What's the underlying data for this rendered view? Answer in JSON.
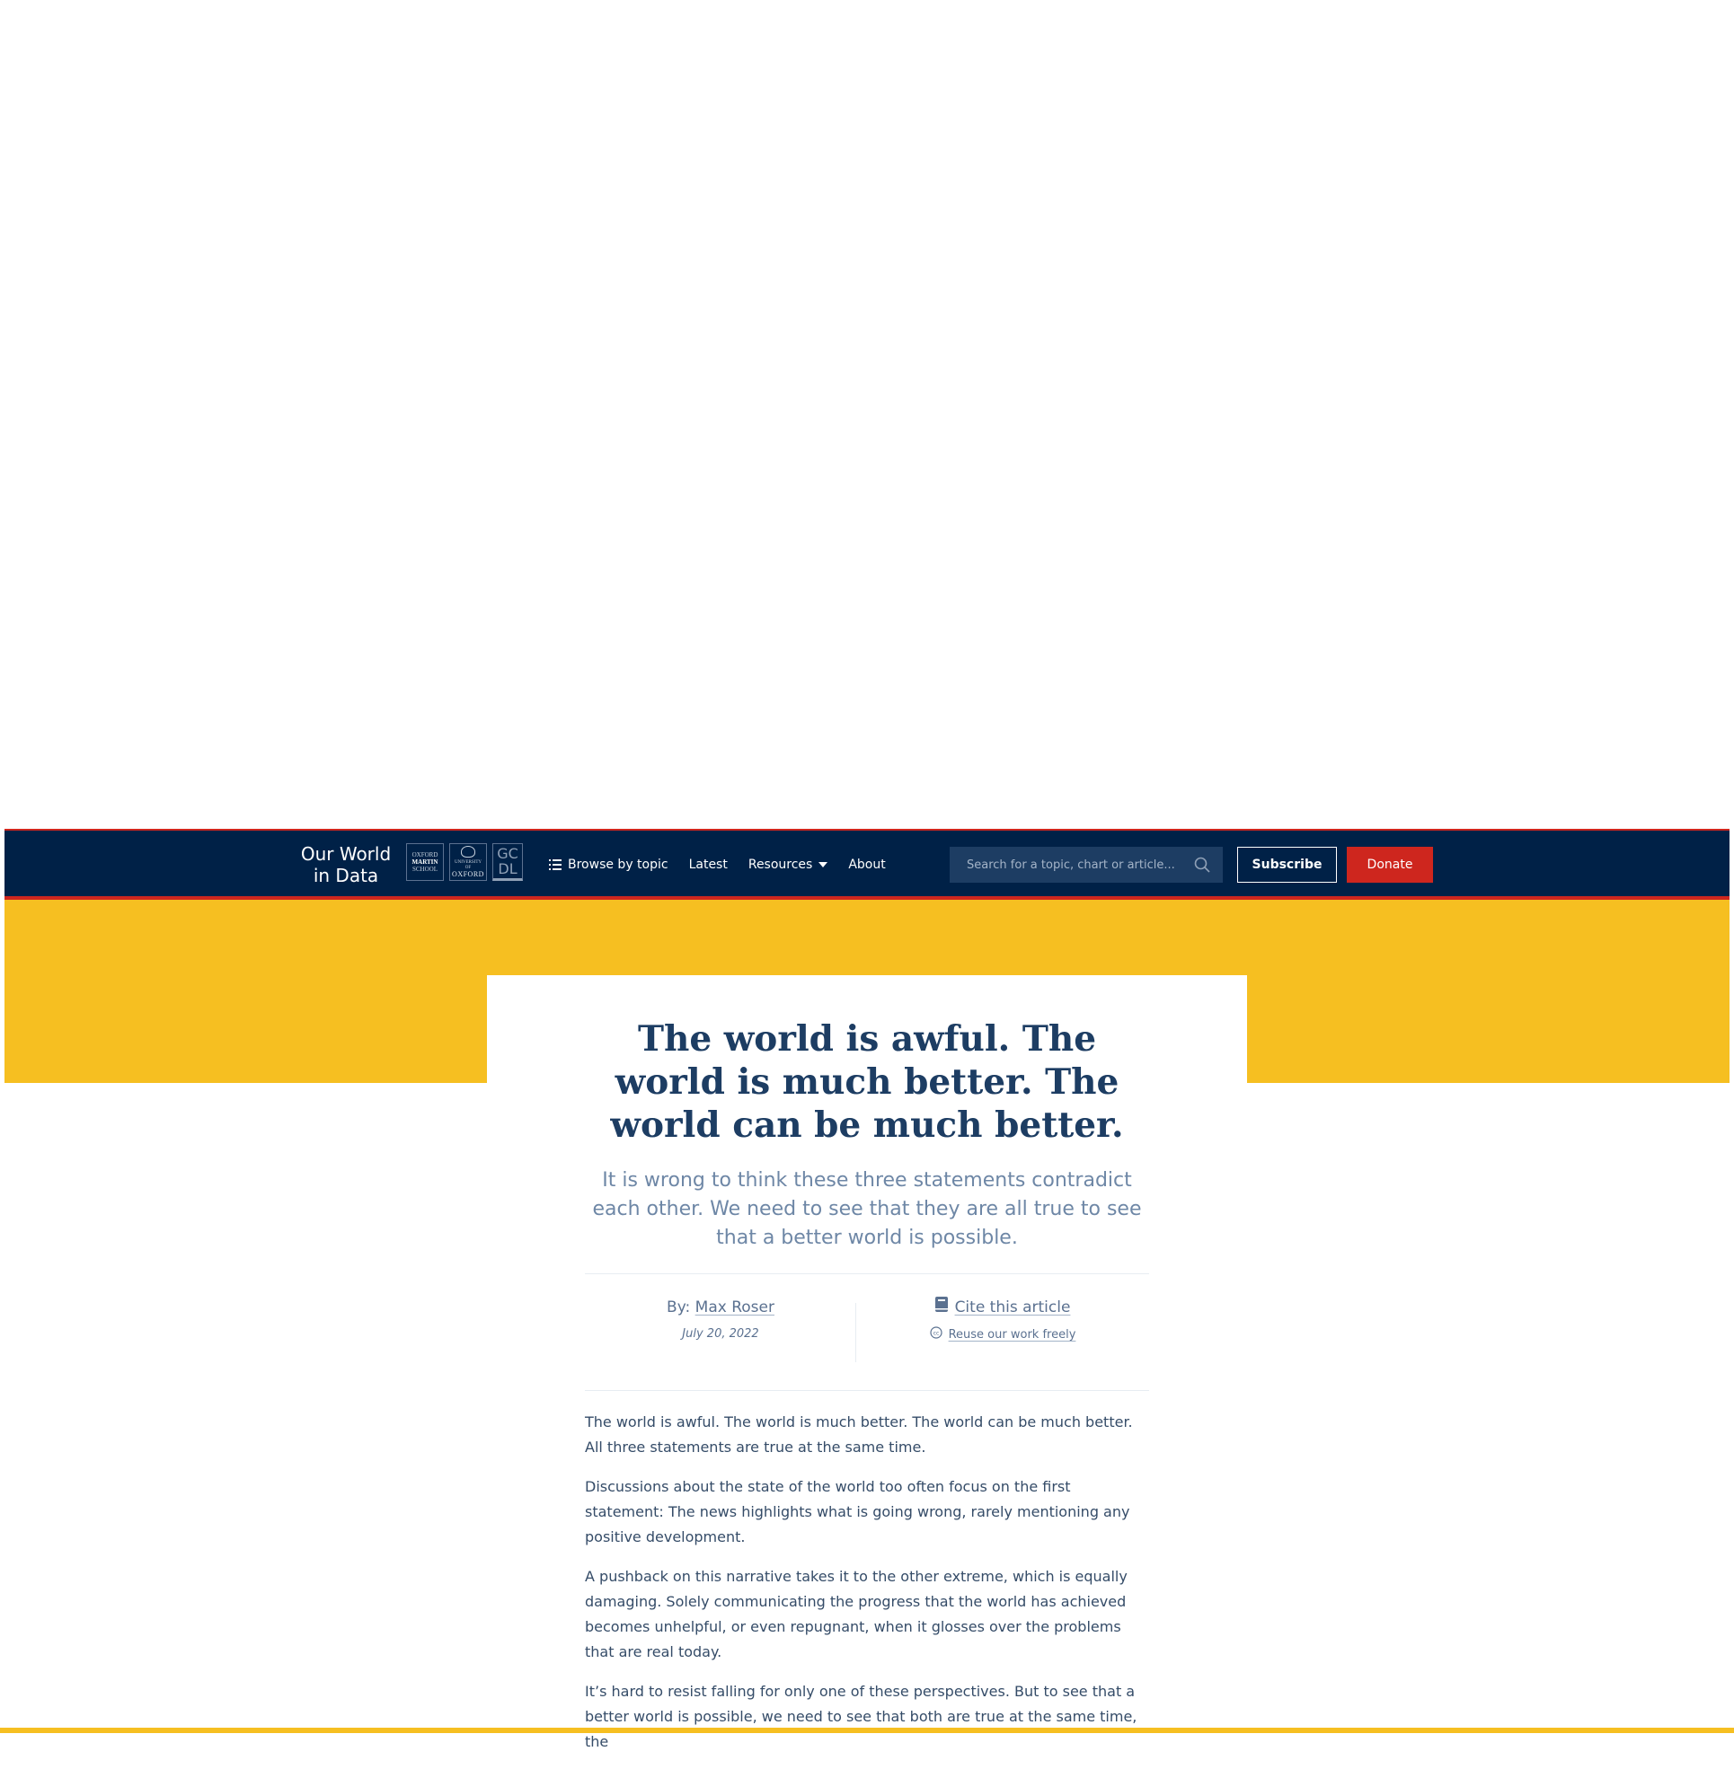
{
  "header": {
    "brand_line1": "Our World",
    "brand_line2": "in Data",
    "partners": {
      "martin": [
        "OXFORD",
        "MARTIN",
        "SCHOOL"
      ],
      "oxford": [
        "UNIVERSITY OF",
        "OXFORD"
      ],
      "gcdl": [
        "GC",
        "DL"
      ]
    },
    "nav": {
      "browse_label": "Browse by topic",
      "latest_label": "Latest",
      "resources_label": "Resources",
      "about_label": "About"
    },
    "search": {
      "placeholder": "Search for a topic, chart or article..."
    },
    "subscribe_label": "Subscribe",
    "donate_label": "Donate"
  },
  "colors": {
    "navy": "#002147",
    "red": "#ce261e",
    "yellow": "#f6bf21",
    "title": "#1d3d63",
    "muted": "#6e87a6"
  },
  "article": {
    "title": "The world is awful. The world is much better. The world can be much better.",
    "subtitle": "It is wrong to think these three statements contradict each other. We need to see that they are all true to see that a better world is possible.",
    "byline_prefix": "By:",
    "author": "Max Roser",
    "date": "July 20, 2022",
    "cite_label": "Cite this article",
    "reuse_label": "Reuse our work freely",
    "paragraphs": [
      "The world is awful. The world is much better. The world can be much better. All three statements are true at the same time.",
      "Discussions about the state of the world too often focus on the first statement: The news highlights what is going wrong, rarely mentioning any positive development.",
      "A pushback on this narrative takes it to the other extreme, which is equally damaging. Solely communicating the progress that the world has achieved becomes unhelpful, or even repugnant, when it glosses over the problems that are real today.",
      "It’s hard to resist falling for only one of these perspectives. But to see that a better world is possible, we need to see that both are true at the same time, the"
    ]
  }
}
